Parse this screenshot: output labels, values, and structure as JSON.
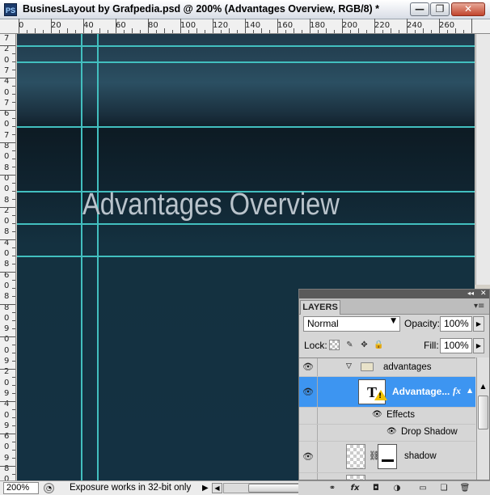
{
  "window": {
    "app_icon": "PS",
    "title": "BusinesLayout by Grafpedia.psd @ 200% (Advantages Overview, RGB/8) *",
    "minimize_glyph": "—",
    "maximize_glyph": "❐",
    "close_glyph": "✕"
  },
  "rulers": {
    "horizontal": [
      "0",
      "20",
      "40",
      "60",
      "80",
      "100",
      "120",
      "140",
      "160",
      "180",
      "200",
      "220",
      "240",
      "260"
    ],
    "vertical": [
      "7",
      "2",
      "0",
      "7",
      "4",
      "0",
      "7",
      "6",
      "0",
      "7",
      "8",
      "0",
      "8",
      "0",
      "0",
      "8",
      "2",
      "0",
      "8",
      "4",
      "0",
      "8",
      "6",
      "0",
      "8",
      "8",
      "0",
      "9",
      "0",
      "0",
      "9",
      "2",
      "0",
      "9",
      "4",
      "0",
      "9",
      "6",
      "0",
      "9",
      "8",
      "0",
      "1",
      "0",
      "0"
    ]
  },
  "canvas": {
    "heading_text": "Advantages Overview",
    "background_colors": [
      "#2b4f62",
      "#0d1b24",
      "#143142"
    ],
    "guide_color": "#42bfbf"
  },
  "status_bar": {
    "zoom": "200%",
    "message": "Exposure works in 32-bit only",
    "menu_arrow": "▶",
    "scroll_left": "◀",
    "scroll_right": "▶"
  },
  "layers_panel": {
    "collapse_glyph": "◂◂",
    "close_glyph": "✕",
    "tab_label": "LAYERS",
    "menu_glyph": "▾≡",
    "blend_mode": "Normal",
    "opacity_label": "Opacity:",
    "opacity_value": "100%",
    "lock_label": "Lock:",
    "fill_label": "Fill:",
    "fill_value": "100%",
    "layers": {
      "group": {
        "name": "advantages",
        "expanded": true
      },
      "text_layer": {
        "thumb_glyph": "T",
        "name": "Advantage...",
        "fx": "fx",
        "selected": true
      },
      "effects_label": "Effects",
      "drop_shadow_label": "Drop Shadow",
      "shadow_layer": {
        "name": "shadow"
      }
    }
  },
  "panel_footer": {
    "icons": [
      "link-icon",
      "fx-icon",
      "mask-icon",
      "adjustment-icon",
      "folder-icon",
      "new-layer-icon",
      "trash-icon"
    ]
  }
}
